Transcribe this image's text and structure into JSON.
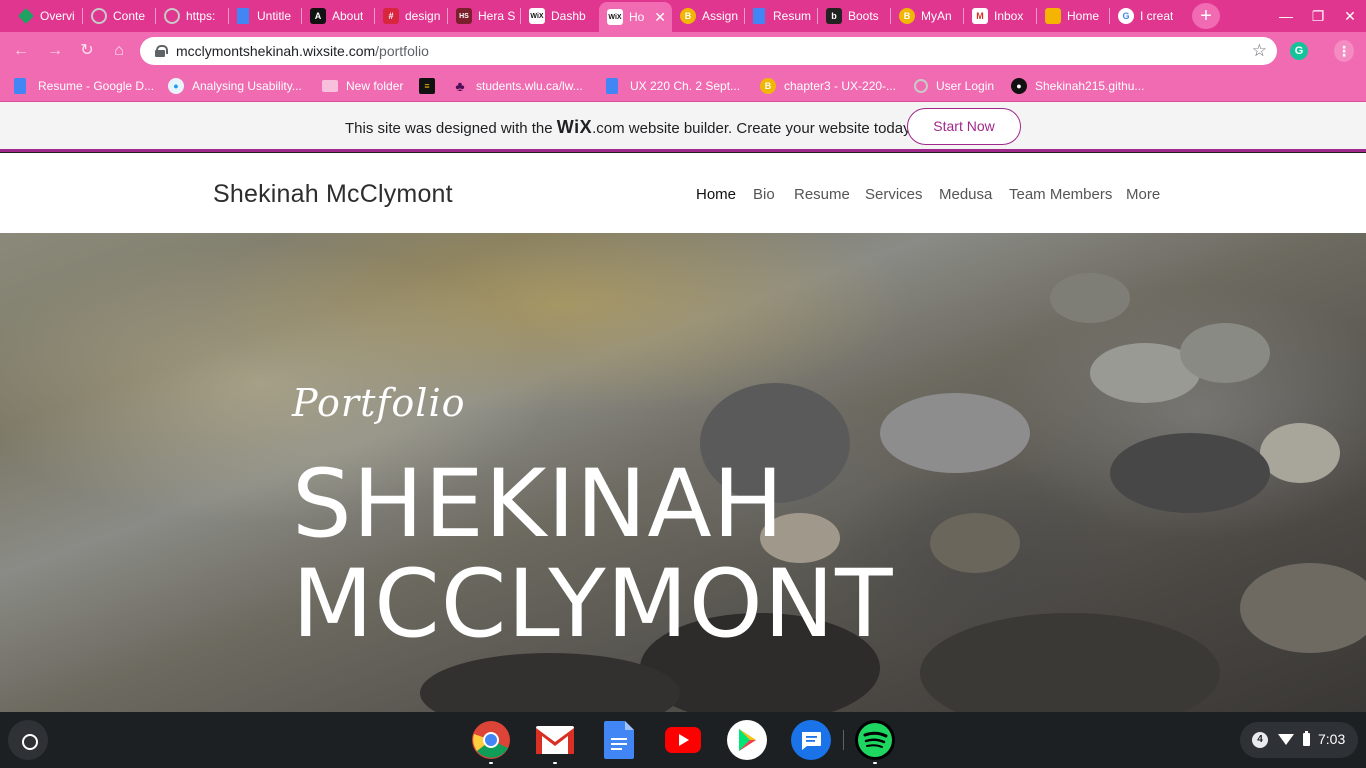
{
  "browser": {
    "tabs": [
      {
        "label": "Overvi",
        "favicon": "diamond-icon",
        "color": "#1ea362"
      },
      {
        "label": "Conte",
        "favicon": "globe-icon",
        "color": "#999999"
      },
      {
        "label": "https:",
        "favicon": "globe-icon",
        "color": "#999999"
      },
      {
        "label": "Untitle",
        "favicon": "docs-icon",
        "color": "#4285f4"
      },
      {
        "label": "About",
        "favicon": "a-logo-icon",
        "color": "#111111"
      },
      {
        "label": "design",
        "favicon": "design-icon",
        "color": "#d7263d"
      },
      {
        "label": "Hera S",
        "favicon": "hs-icon",
        "color": "#7a1f2b"
      },
      {
        "label": "Dashb",
        "favicon": "wix-icon",
        "color": "#ffffff"
      },
      {
        "label": "Ho",
        "favicon": "wix-icon",
        "color": "#ffffff",
        "active": true
      },
      {
        "label": "Assign",
        "favicon": "b-coin-icon",
        "color": "#f2b705"
      },
      {
        "label": "Resum",
        "favicon": "docs-icon",
        "color": "#4285f4"
      },
      {
        "label": "Boots",
        "favicon": "bootstrap-icon",
        "color": "#222222"
      },
      {
        "label": "MyAn",
        "favicon": "b-coin-icon",
        "color": "#f2b705"
      },
      {
        "label": "Inbox",
        "favicon": "gmail-icon",
        "color": "#ffffff"
      },
      {
        "label": "Home",
        "favicon": "slides-icon",
        "color": "#f4b400"
      },
      {
        "label": "I creat",
        "favicon": "google-icon",
        "color": "#ffffff"
      }
    ],
    "url_host": "mcclymontshekinah.wixsite.com",
    "url_path": "/portfolio",
    "bookmarks": [
      {
        "label": "Resume - Google D...",
        "icon": "docs-icon"
      },
      {
        "label": "Analysing Usability...",
        "icon": "bird-icon"
      },
      {
        "label": "New folder",
        "icon": "folder-icon"
      },
      {
        "label": "",
        "icon": "flag-icon"
      },
      {
        "label": "students.wlu.ca/lw...",
        "icon": "leaf-icon"
      },
      {
        "label": "UX 220 Ch. 2 Sept...",
        "icon": "docs-icon"
      },
      {
        "label": "chapter3 - UX-220-...",
        "icon": "b-coin-icon"
      },
      {
        "label": "User Login",
        "icon": "globe-icon"
      },
      {
        "label": "Shekinah215.githu...",
        "icon": "github-icon"
      }
    ]
  },
  "wix_banner": {
    "text_before": "This site was designed with the ",
    "logo": "WiX",
    "text_after": ".com website builder. Create your website today.",
    "cta": "Start Now"
  },
  "site": {
    "title": "Shekinah McClymont",
    "nav": [
      "Home",
      "Bio",
      "Resume",
      "Services",
      "Medusa",
      "Team Members",
      "More"
    ],
    "hero_script": "Portfolio",
    "hero_line1": "SHEKINAH",
    "hero_line2": "MCCLYMONT"
  },
  "shelf": {
    "apps": [
      "chrome-icon",
      "gmail-icon",
      "docs-icon",
      "youtube-icon",
      "play-store-icon",
      "messages-icon",
      "spotify-icon"
    ],
    "notification_count": "4",
    "time": "7:03"
  }
}
